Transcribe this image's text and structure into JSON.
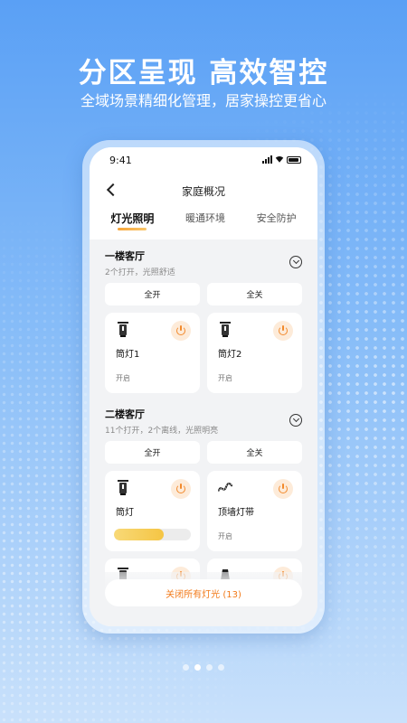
{
  "headline": "分区呈现 高效智控",
  "subline": "全域场景精细化管理，居家操控更省心",
  "status": {
    "time": "9:41"
  },
  "nav": {
    "title": "家庭概况"
  },
  "tabs": [
    "灯光照明",
    "暖通环境",
    "安全防护"
  ],
  "sections": [
    {
      "title": "一楼客厅",
      "subtitle": "2个打开，光照舒适",
      "all_on": "全开",
      "all_off": "全关",
      "devices": [
        {
          "name": "筒灯1",
          "state": "开启",
          "icon": "downlight-icon"
        },
        {
          "name": "筒灯2",
          "state": "开启",
          "icon": "downlight-icon"
        }
      ]
    },
    {
      "title": "二楼客厅",
      "subtitle": "11个打开，2个离线，光照明亮",
      "all_on": "全开",
      "all_off": "全关",
      "devices": [
        {
          "name": "筒灯",
          "brightness": 0.65,
          "icon": "downlight-icon"
        },
        {
          "name": "顶墙灯带",
          "state": "开启",
          "icon": "light-strip-icon"
        }
      ]
    }
  ],
  "close_all": "关闭所有灯光 (13)",
  "colors": {
    "accent": "#f28a2c",
    "bg": "#f2f3f5",
    "bar": "#f5c544"
  }
}
